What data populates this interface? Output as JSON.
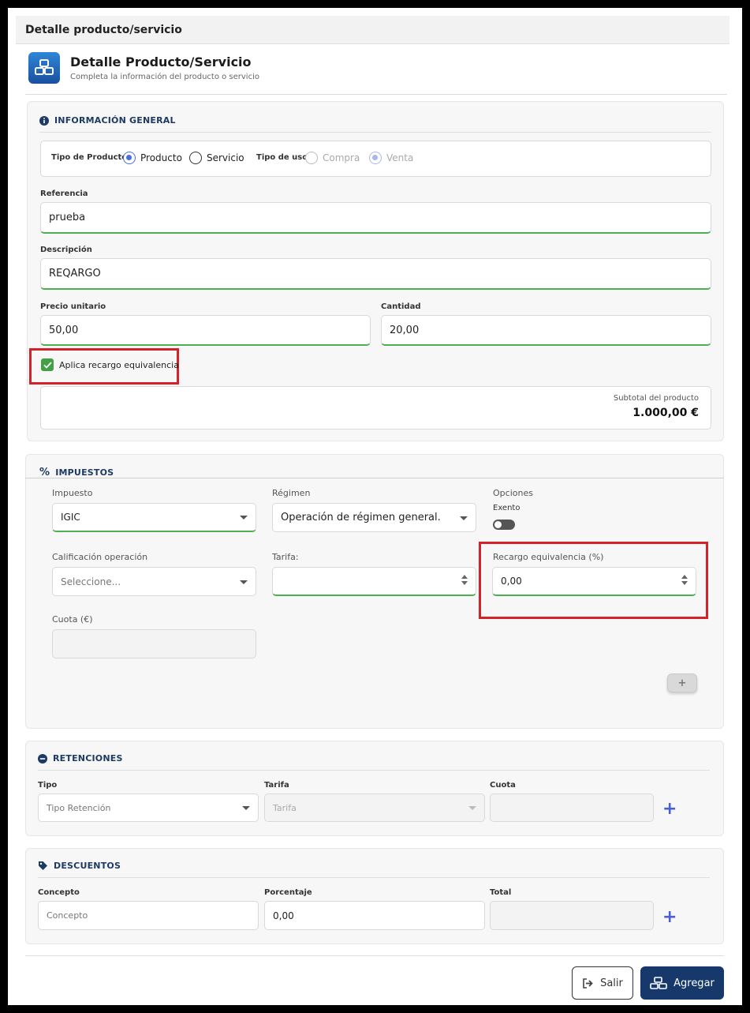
{
  "window": {
    "title": "Detalle producto/servicio"
  },
  "header": {
    "title": "Detalle Producto/Servicio",
    "subtitle": "Completa la información del producto o servicio",
    "icon": "boxes-icon",
    "brand_color": "#1a4fa0"
  },
  "general": {
    "title": "INFORMACIÓN GENERAL",
    "tipo_producto_label": "Tipo de Producto",
    "opt_producto": "Producto",
    "opt_servicio": "Servicio",
    "tipo_uso_label": "Tipo de uso",
    "opt_compra": "Compra",
    "opt_venta": "Venta",
    "referencia_label": "Referencia",
    "referencia_value": "prueba",
    "descripcion_label": "Descripción",
    "descripcion_value": "REQARGO",
    "precio_label": "Precio unitario",
    "precio_value": "50,00",
    "cantidad_label": "Cantidad",
    "cantidad_value": "20,00",
    "recargo_checkbox_label": "Aplica recargo equivalencia",
    "subtotal_label": "Subtotal del producto",
    "subtotal_value": "1.000,00 €"
  },
  "impuestos": {
    "title": "IMPUESTOS",
    "impuesto_label": "Impuesto",
    "impuesto_value": "IGIC",
    "regimen_label": "Régimen",
    "regimen_value": "Operación de régimen general.",
    "opciones_label": "Opciones",
    "exento_label": "Exento",
    "calificacion_label": "Calificación operación",
    "calificacion_placeholder": "Seleccione...",
    "tarifa_label": "Tarifa:",
    "tarifa_value": "",
    "recargo_label": "Recargo equivalencia (%)",
    "recargo_value": "0,00",
    "cuota_label": "Cuota (€)",
    "cuota_value": "",
    "add_label": "+"
  },
  "retenciones": {
    "title": "RETENCIONES",
    "tipo_label": "Tipo",
    "tipo_placeholder": "Tipo Retención",
    "tarifa_label": "Tarifa",
    "tarifa_placeholder": "Tarifa",
    "cuota_label": "Cuota",
    "add_label": "+"
  },
  "descuentos": {
    "title": "DESCUENTOS",
    "concepto_label": "Concepto",
    "concepto_placeholder": "Concepto",
    "porcentaje_label": "Porcentaje",
    "porcentaje_value": "0,00",
    "total_label": "Total",
    "add_label": "+"
  },
  "footer": {
    "salir_label": "Salir",
    "agregar_label": "Agregar"
  },
  "colors": {
    "accent_green": "#4caf50",
    "highlight_red": "#d3222a",
    "primary_dark": "#1d3a63"
  }
}
